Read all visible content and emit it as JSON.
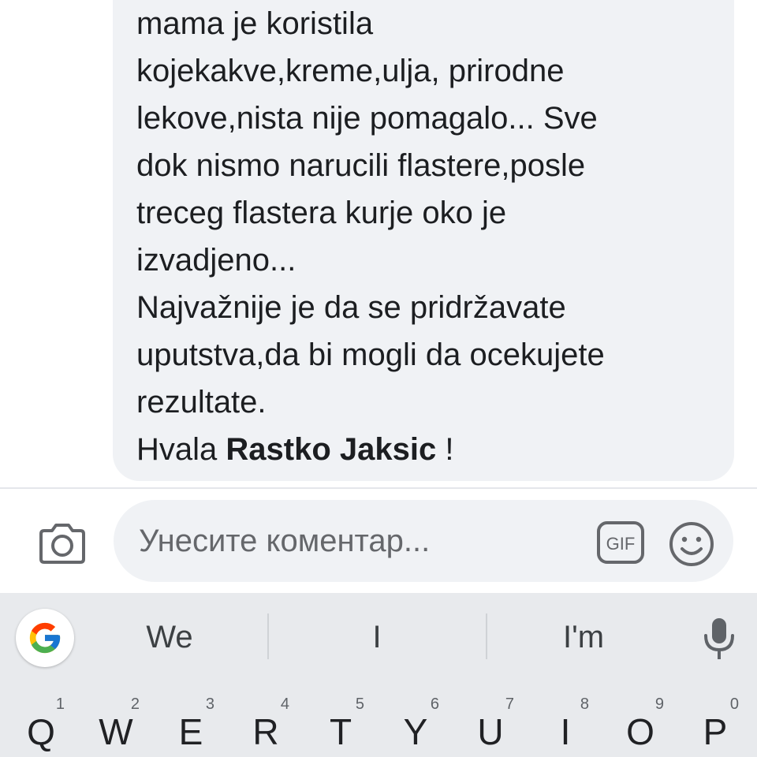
{
  "comment": {
    "lines": [
      "mama je koristila",
      "kojekakve,kreme,ulja, prirodne",
      "lekove,nista nije pomagalo... Sve",
      "dok nismo narucili flastere,posle",
      "treceg flastera kurje oko je",
      "izvadjeno...",
      "Najvažnije je da se pridržavate",
      "uputstva,da bi mogli da ocekujete",
      "rezultate."
    ],
    "thanks_prefix": "Hvala ",
    "mention": "Rastko Jaksic",
    "thanks_suffix": " !"
  },
  "composer": {
    "placeholder": "Унесите коментар...",
    "gif_label": "GIF",
    "camera_icon": "camera-icon",
    "emoji_icon": "smiley-icon"
  },
  "keyboard": {
    "suggestions": [
      "We",
      "I",
      "I'm"
    ],
    "google_icon": "google-g-icon",
    "mic_icon": "mic-icon",
    "keys": [
      {
        "letter": "Q",
        "hint": "1"
      },
      {
        "letter": "W",
        "hint": "2"
      },
      {
        "letter": "E",
        "hint": "3"
      },
      {
        "letter": "R",
        "hint": "4"
      },
      {
        "letter": "T",
        "hint": "5"
      },
      {
        "letter": "Y",
        "hint": "6"
      },
      {
        "letter": "U",
        "hint": "7"
      },
      {
        "letter": "I",
        "hint": "8"
      },
      {
        "letter": "O",
        "hint": "9"
      },
      {
        "letter": "P",
        "hint": "0"
      }
    ]
  },
  "colors": {
    "bubble": "#f0f2f5",
    "text": "#1c1e21",
    "placeholder": "#65676b",
    "keyboard_bg": "#e8eaed"
  }
}
